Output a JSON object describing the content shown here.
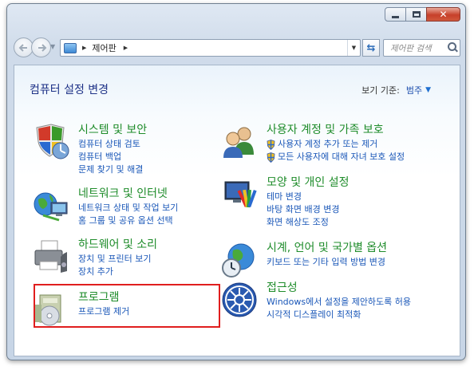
{
  "window": {
    "caption_buttons": {
      "minimize": "minimize-icon",
      "maximize": "maximize-icon",
      "close": "close-icon"
    }
  },
  "toolbar": {
    "breadcrumb": "제어판",
    "search_placeholder": "제어판 검색"
  },
  "page": {
    "title": "컴퓨터 설정 변경",
    "view_by_label": "보기 기준:",
    "view_by_value": "범주"
  },
  "categories": [
    {
      "title": "시스템 및 보안",
      "icon": "shield-computer-icon",
      "links": [
        "컴퓨터 상태 검토",
        "컴퓨터 백업",
        "문제 찾기 및 해결"
      ]
    },
    {
      "title": "네트워크 및 인터넷",
      "icon": "network-globe-icon",
      "links": [
        "네트워크 상태 및 작업 보기",
        "홈 그룹 및 공유 옵션 선택"
      ]
    },
    {
      "title": "하드웨어 및 소리",
      "icon": "printer-icon",
      "links": [
        "장치 및 프린터 보기",
        "장치 추가"
      ]
    },
    {
      "title": "프로그램",
      "icon": "programs-icon",
      "links": [
        "프로그램 제거"
      ]
    },
    {
      "title": "사용자 계정 및 가족 보호",
      "icon": "users-icon",
      "links": [
        "사용자 계정 추가 또는 제거",
        "모든 사용자에 대해 자녀 보호 설정"
      ]
    },
    {
      "title": "모양 및 개인 설정",
      "icon": "appearance-icon",
      "links": [
        "테마 변경",
        "바탕 화면 배경 변경",
        "화면 해상도 조정"
      ]
    },
    {
      "title": "시계, 언어 및 국가별 옵션",
      "icon": "clock-globe-icon",
      "links": [
        "키보드 또는 기타 입력 방법 변경"
      ]
    },
    {
      "title": "접근성",
      "icon": "accessibility-icon",
      "links": [
        "Windows에서 설정을 제안하도록 허용",
        "시각적 디스플레이 최적화"
      ]
    }
  ],
  "colors": {
    "category_title": "#1e8c2a",
    "link": "#1a57b8",
    "page_title": "#1e3287",
    "highlight_border": "#e01e1e"
  }
}
